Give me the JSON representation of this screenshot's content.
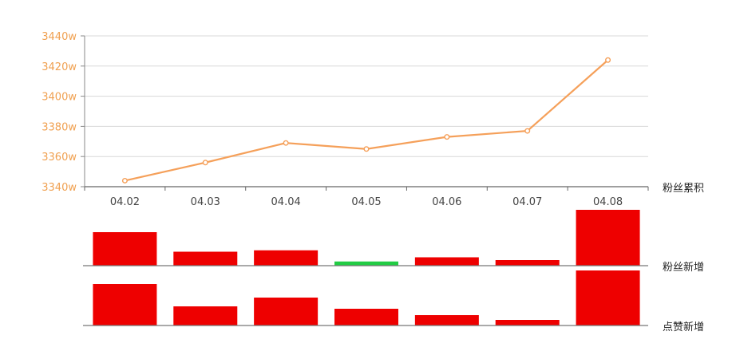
{
  "chart_data": [
    {
      "type": "line",
      "categories": [
        "04.02",
        "04.03",
        "04.04",
        "04.05",
        "04.06",
        "04.07",
        "04.08"
      ],
      "values": [
        3344,
        3356,
        3369,
        3365,
        3373,
        3377,
        3424
      ],
      "ylim": [
        3340,
        3440
      ],
      "yticks": [
        3340,
        3360,
        3380,
        3400,
        3420,
        3440
      ],
      "ytick_suffix": "w",
      "label": "粉丝累积",
      "color": "#f5a05a",
      "grid": true
    },
    {
      "type": "bar",
      "categories": [
        "04.02",
        "04.03",
        "04.04",
        "04.05",
        "04.06",
        "04.07",
        "04.08"
      ],
      "values": [
        12,
        5,
        5.5,
        -1.5,
        3,
        2,
        20
      ],
      "label": "粉丝新增",
      "colors": {
        "positive": "#ee0000",
        "negative": "#22cc44"
      }
    },
    {
      "type": "bar",
      "categories": [
        "04.02",
        "04.03",
        "04.04",
        "04.05",
        "04.06",
        "04.07",
        "04.08"
      ],
      "values": [
        52,
        24,
        35,
        21,
        13,
        7,
        69
      ],
      "label": "点赞新增",
      "colors": {
        "positive": "#ee0000"
      }
    }
  ]
}
